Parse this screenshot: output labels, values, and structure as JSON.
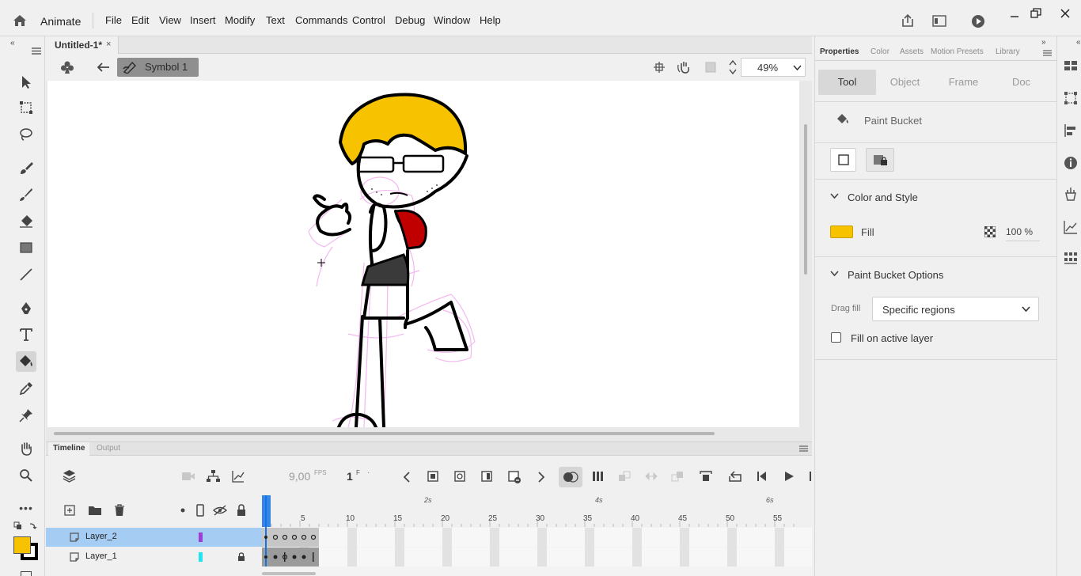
{
  "app": {
    "name": "Animate"
  },
  "menu": [
    "File",
    "Edit",
    "View",
    "Insert",
    "Modify",
    "Text",
    "Commands",
    "Control",
    "Debug",
    "Window",
    "Help"
  ],
  "document": {
    "tab_label": "Untitled-1*",
    "close_glyph": "×"
  },
  "editbar": {
    "symbol_label": "Symbol 1",
    "zoom": "49%"
  },
  "timeline": {
    "tabs": [
      "Timeline",
      "Output"
    ],
    "fps": "9,00",
    "fps_unit": "FPS",
    "current_frame": "1",
    "frame_unit": "F",
    "time_markers": [
      "2s",
      "4s",
      "6s"
    ],
    "frame_numbers": [
      "5",
      "10",
      "15",
      "20",
      "25",
      "30",
      "35",
      "40",
      "45",
      "50",
      "55"
    ],
    "layers": [
      {
        "name": "Layer_2",
        "color": "#9d3fd6",
        "selected": true,
        "locked": false
      },
      {
        "name": "Layer_1",
        "color": "#23e3ee",
        "selected": false,
        "locked": true
      }
    ]
  },
  "properties": {
    "tabs": [
      "Properties",
      "Color",
      "Assets",
      "Motion Presets",
      "Library"
    ],
    "segments": [
      "Tool",
      "Object",
      "Frame",
      "Doc"
    ],
    "tool_name": "Paint Bucket",
    "color_style_title": "Color and Style",
    "fill_label": "Fill",
    "fill_color": "#f7c300",
    "fill_alpha": "100 %",
    "options_title": "Paint Bucket Options",
    "drag_fill_label": "Drag fill",
    "drag_fill_value": "Specific regions",
    "fill_active_layer_label": "Fill on active layer"
  },
  "colors": {
    "stroke": "#000000",
    "fill": "#f7c300",
    "accent": "#1473e6"
  },
  "icons": [
    "home-icon",
    "share-icon",
    "panel-icon",
    "play-icon",
    "selection-tool-icon",
    "paint-bucket-icon"
  ]
}
